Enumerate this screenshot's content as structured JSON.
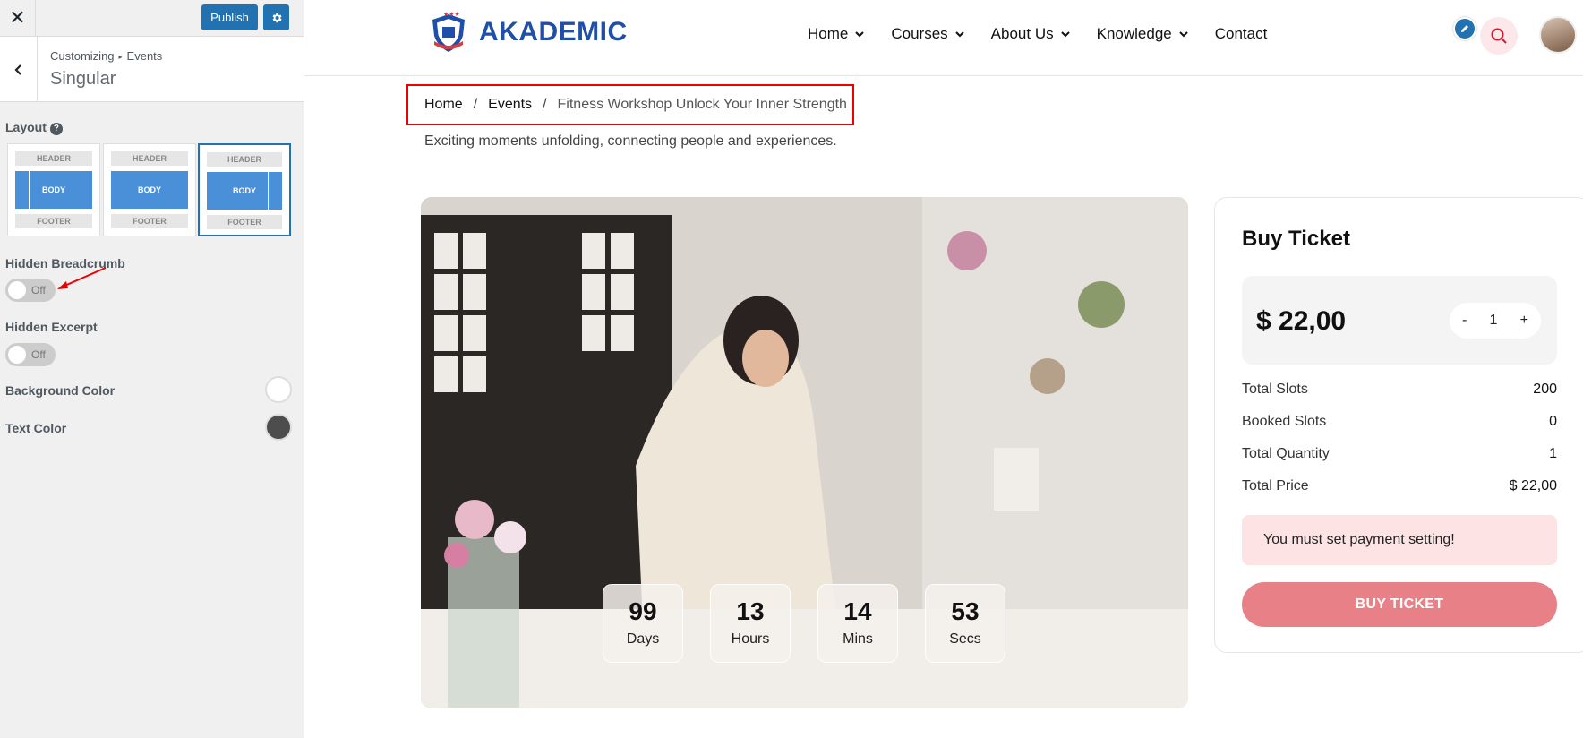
{
  "customizer": {
    "close_icon": "close-icon",
    "publish_label": "Publish",
    "gear_icon": "gear-icon",
    "breadcrumb_root": "Customizing",
    "breadcrumb_section": "Events",
    "section_title": "Singular",
    "layout_label": "Layout",
    "layout_options": [
      {
        "header": "HEADER",
        "body": "BODY",
        "footer": "FOOTER",
        "variant": "left-sidebar",
        "selected": false
      },
      {
        "header": "HEADER",
        "body": "BODY",
        "footer": "FOOTER",
        "variant": "full-width",
        "selected": false
      },
      {
        "header": "HEADER",
        "body": "BODY",
        "footer": "FOOTER",
        "variant": "right-sidebar",
        "selected": true
      }
    ],
    "hidden_breadcrumb_label": "Hidden Breadcrumb",
    "hidden_breadcrumb_state": "Off",
    "hidden_excerpt_label": "Hidden Excerpt",
    "hidden_excerpt_state": "Off",
    "background_color_label": "Background Color",
    "background_color_value": "#ffffff",
    "text_color_label": "Text Color",
    "text_color_value": "#4d4d4d"
  },
  "site": {
    "logo_text": "AKADEMIC",
    "nav": [
      {
        "label": "Home",
        "has_dropdown": true
      },
      {
        "label": "Courses",
        "has_dropdown": true
      },
      {
        "label": "About Us",
        "has_dropdown": true
      },
      {
        "label": "Knowledge",
        "has_dropdown": true
      },
      {
        "label": "Contact",
        "has_dropdown": false
      }
    ]
  },
  "breadcrumb": {
    "home": "Home",
    "sep1": "/",
    "events": "Events",
    "sep2": "/",
    "current": "Fitness Workshop Unlock Your Inner Strength"
  },
  "excerpt": "Exciting moments unfolding, connecting people and experiences.",
  "countdown": [
    {
      "value": "99",
      "unit": "Days"
    },
    {
      "value": "13",
      "unit": "Hours"
    },
    {
      "value": "14",
      "unit": "Mins"
    },
    {
      "value": "53",
      "unit": "Secs"
    }
  ],
  "ticket": {
    "title": "Buy Ticket",
    "price": "$ 22,00",
    "qty_minus": "-",
    "qty_value": "1",
    "qty_plus": "+",
    "rows": [
      {
        "label": "Total Slots",
        "value": "200"
      },
      {
        "label": "Booked Slots",
        "value": "0"
      },
      {
        "label": "Total Quantity",
        "value": "1"
      },
      {
        "label": "Total Price",
        "value": "$ 22,00"
      }
    ],
    "alert": "You must set payment setting!",
    "button": "BUY TICKET"
  },
  "colors": {
    "wp_blue": "#2271b1",
    "brand_blue": "#1f4fa8",
    "buy_button": "#e88087",
    "alert_bg": "#fde3e3",
    "highlight_red": "#ee0000"
  }
}
